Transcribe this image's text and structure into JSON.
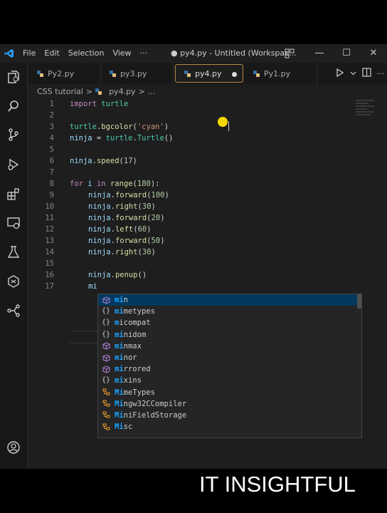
{
  "titlebar": {
    "menu": [
      "File",
      "Edit",
      "Selection",
      "View",
      "···"
    ],
    "title": "● py4.py - Untitled (Workspac...",
    "controls": {
      "minimize": "—",
      "maximize": "☐",
      "close": "✕"
    }
  },
  "tabs": [
    {
      "label": "Py2.py",
      "active": false
    },
    {
      "label": "py3.py",
      "active": false
    },
    {
      "label": "py4.py",
      "active": true,
      "dirty": true
    },
    {
      "label": "Py1.py",
      "active": false
    }
  ],
  "breadcrumb": {
    "folder": "CSS tutorial",
    "sep1": ">",
    "file": "py4.py",
    "sep2": ">",
    "more": "..."
  },
  "editor": {
    "line_numbers": [
      "1",
      "2",
      "3",
      "4",
      "5",
      "6",
      "7",
      "8",
      "9",
      "10",
      "11",
      "12",
      "13",
      "14",
      "15",
      "16",
      "17"
    ],
    "lines": {
      "l1": [
        "import",
        " turtle"
      ],
      "l3": [
        "turtle",
        ".",
        "bgcolor",
        "(",
        "'cyan'",
        ")"
      ],
      "l4": [
        "ninja",
        " = ",
        "turtle",
        ".",
        "Turtle",
        "()"
      ],
      "l6": [
        "ninja",
        ".",
        "speed",
        "(",
        "17",
        ")"
      ],
      "l8": [
        "for",
        " ",
        "i",
        " ",
        "in",
        " ",
        "range",
        "(",
        "180",
        "):"
      ],
      "l9": [
        "ninja",
        ".",
        "forward",
        "(",
        "100",
        ")"
      ],
      "l10": [
        "ninja",
        ".",
        "right",
        "(",
        "30",
        ")"
      ],
      "l11": [
        "ninja",
        ".",
        "forward",
        "(",
        "20",
        ")"
      ],
      "l12": [
        "ninja",
        ".",
        "left",
        "(",
        "60",
        ")"
      ],
      "l13": [
        "ninja",
        ".",
        "forward",
        "(",
        "50",
        ")"
      ],
      "l14": [
        "ninja",
        ".",
        "right",
        "(",
        "30",
        ")"
      ],
      "l16": [
        "ninja",
        ".",
        "penup",
        "()"
      ],
      "l17": "mi"
    }
  },
  "suggestions": [
    {
      "icon": "cube",
      "match": "mi",
      "rest": "n"
    },
    {
      "icon": "braces",
      "match": "mi",
      "rest": "metypes"
    },
    {
      "icon": "braces",
      "match": "m",
      "rest": "icompat"
    },
    {
      "icon": "braces",
      "match": "mi",
      "rest": "nidom"
    },
    {
      "icon": "cube",
      "match": "mi",
      "rest": "nmax"
    },
    {
      "icon": "cube",
      "match": "mi",
      "rest": "nor"
    },
    {
      "icon": "cube",
      "match": "mi",
      "rest": "rrored"
    },
    {
      "icon": "braces",
      "match": "mi",
      "rest": "xins"
    },
    {
      "icon": "class",
      "match": "Mi",
      "rest": "meTypes"
    },
    {
      "icon": "class",
      "match": "Mi",
      "rest": "ngw32CCompiler"
    },
    {
      "icon": "class",
      "match": "Mi",
      "rest": "niFieldStorage"
    },
    {
      "icon": "class",
      "match": "Mi",
      "rest": "sc"
    }
  ],
  "brand": "IT INSIGHTFUL",
  "colors": {
    "accent": "#007acc",
    "match": "#18a3ff",
    "selected_bg": "#04395e"
  }
}
